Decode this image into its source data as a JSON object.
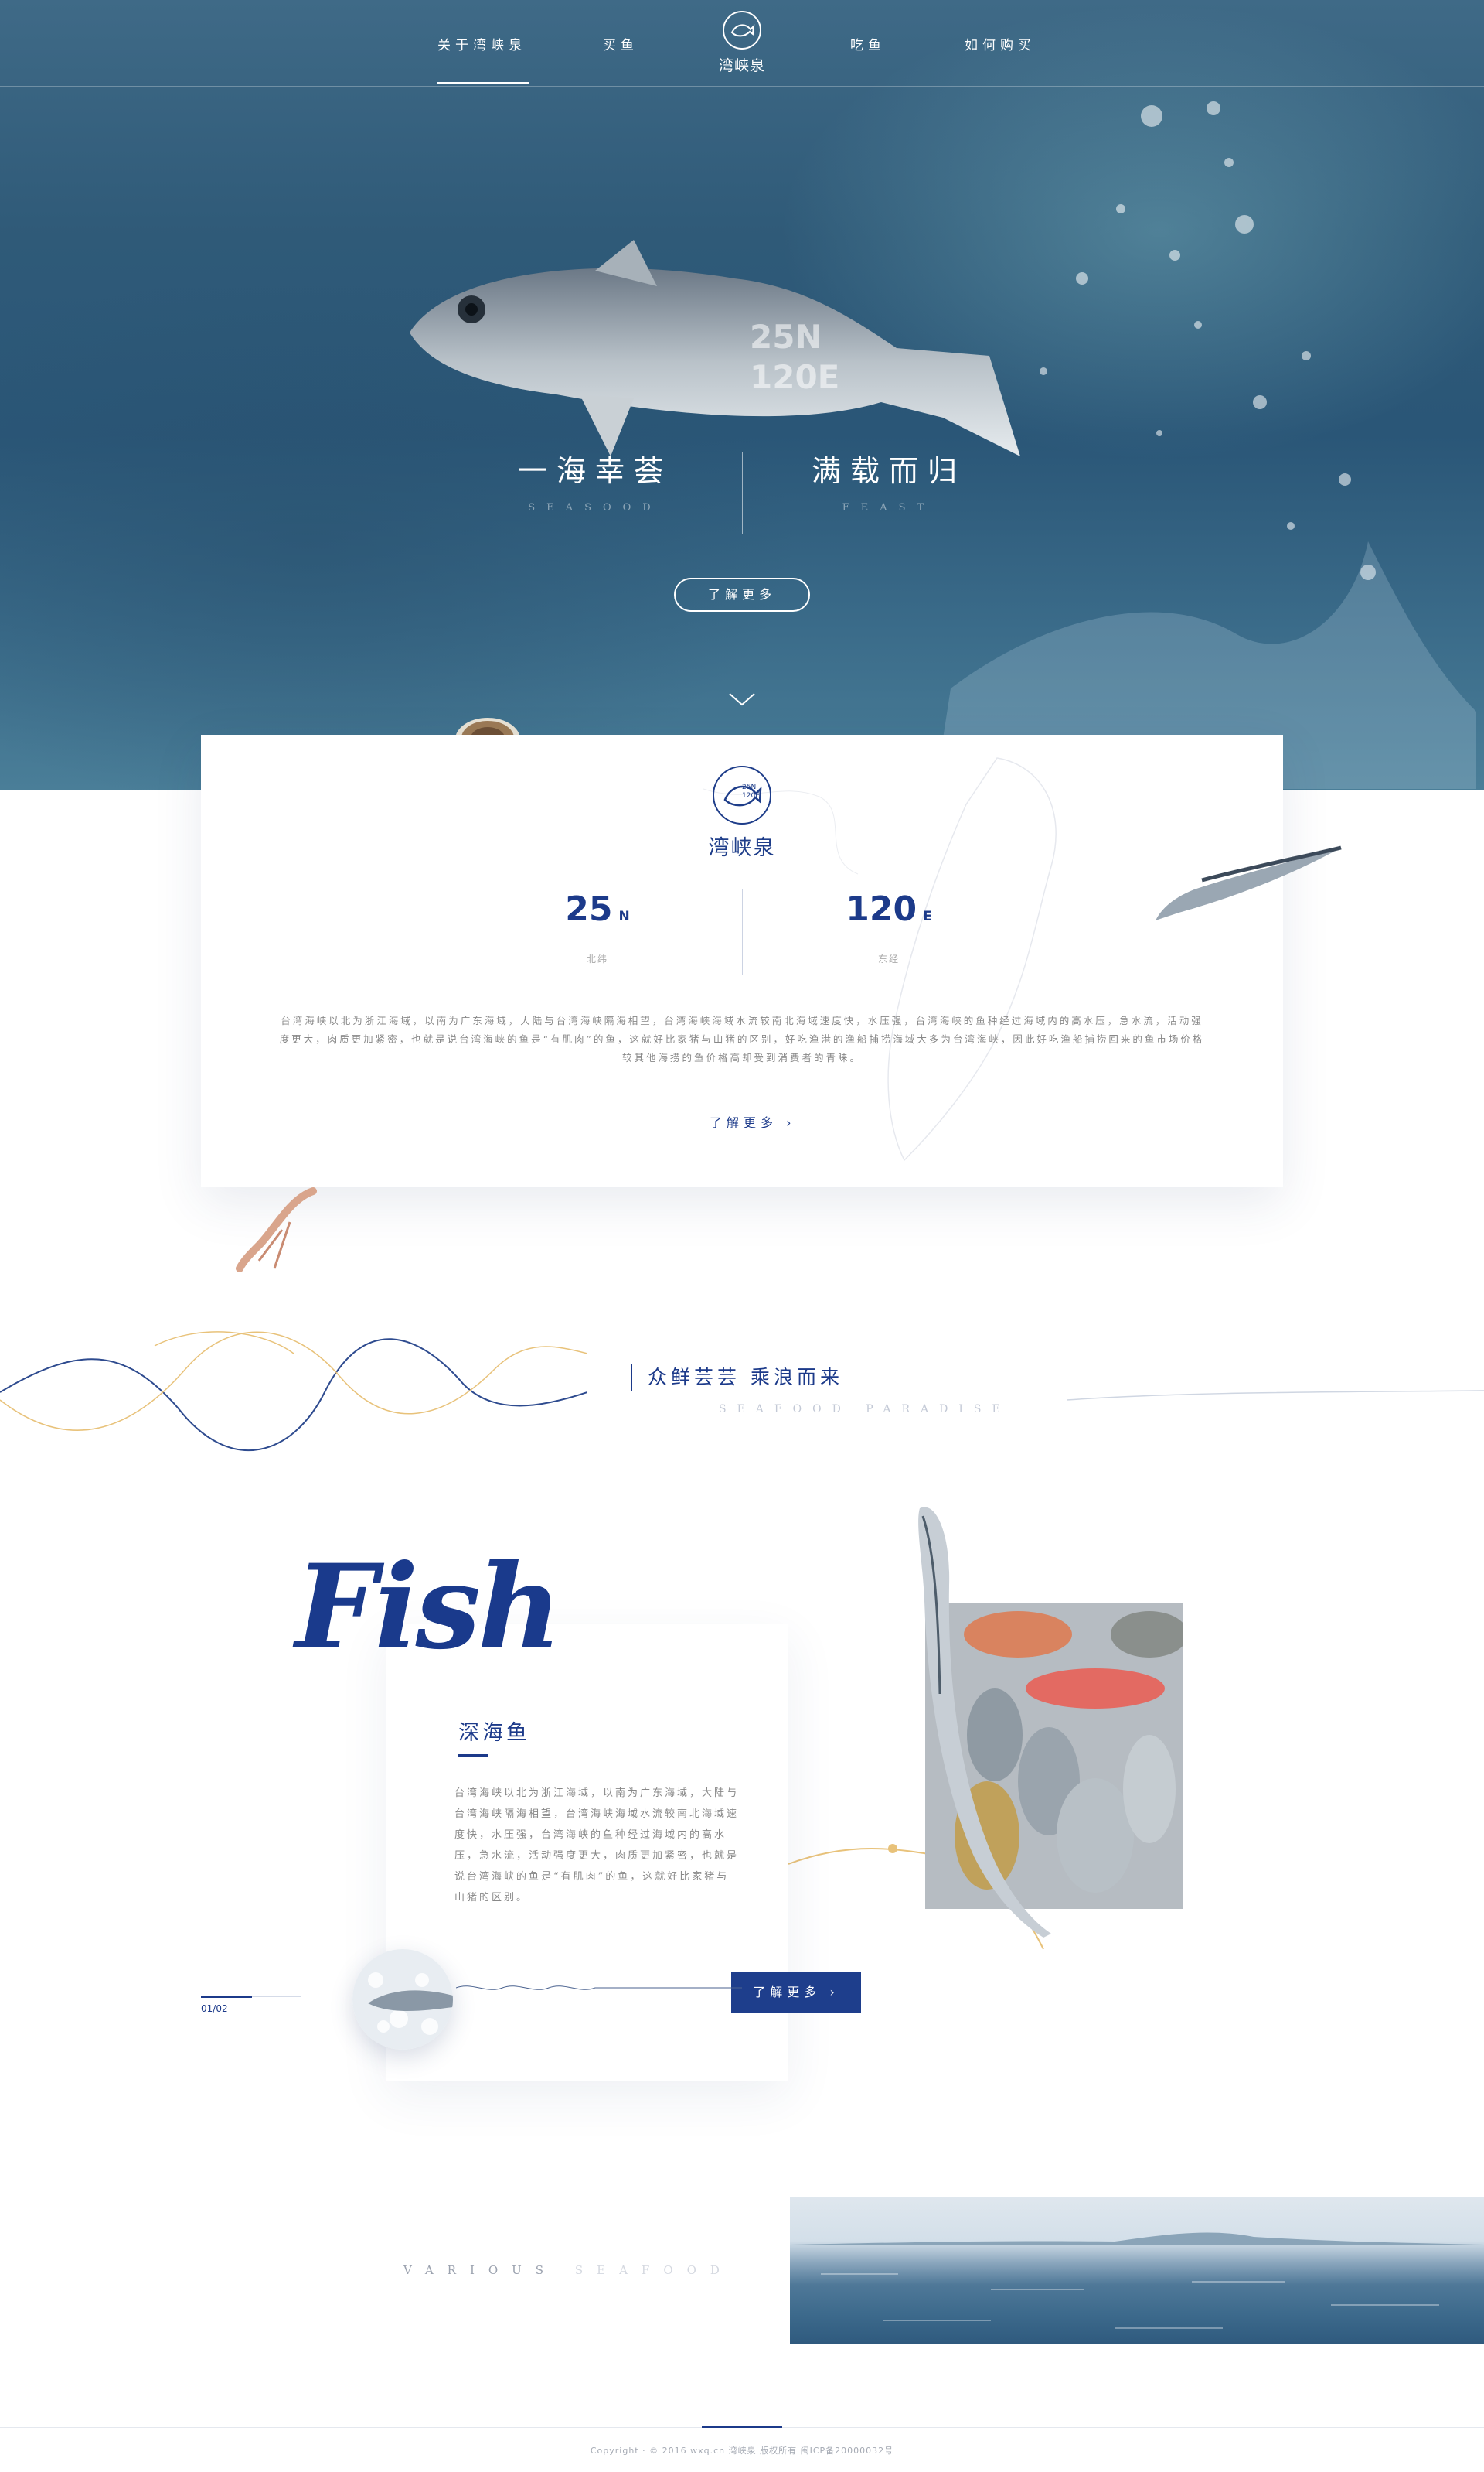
{
  "nav": {
    "items": [
      {
        "label": "关于湾峡泉"
      },
      {
        "label": "买鱼"
      },
      {
        "label": "吃鱼"
      },
      {
        "label": "如何购买"
      }
    ],
    "logo_text": "湾峡泉"
  },
  "hero": {
    "coord_line1": "25N",
    "coord_line2": "120E",
    "left_title": "一海幸荟",
    "left_subtitle": "SEASOOD",
    "right_title": "满载而归",
    "right_subtitle": "FEAST",
    "button_label": "了解更多"
  },
  "intro": {
    "logo_text": "湾峡泉",
    "logo_badge_1": "25N",
    "logo_badge_2": "120E",
    "stat_left": {
      "value": "25",
      "unit": "N",
      "label": "北纬"
    },
    "stat_right": {
      "value": "120",
      "unit": "E",
      "label": "东经"
    },
    "paragraph": "台湾海峡以北为浙江海域，以南为广东海域，大陆与台湾海峡隔海相望，台湾海峡海域水流较南北海域速度快，水压强，台湾海峡的鱼种经过海域内的高水压，急水流，活动强度更大，肉质更加紧密，也就是说台湾海峡的鱼是“有肌肉”的鱼，这就好比家猪与山猪的区别，好吃渔港的渔船捕捞海域大多为台湾海峡，因此好吃渔船捕捞回来的鱼市场价格较其他海捞的鱼价格高却受到消费者的青睐。",
    "more_label": "了解更多 ›"
  },
  "section": {
    "title": "众鲜芸芸  乘浪而来",
    "subtitle": "SEAFOOD  PARADISE",
    "script_word": "Fish",
    "card_title": "深海鱼",
    "card_text": "台湾海峡以北为浙江海域，以南为广东海域，大陆与台湾海峡隔海相望，台湾海峡海域水流较南北海域速度快，水压强，台湾海峡的鱼种经过海域内的高水压，急水流，活动强度更大，肉质更加紧密，也就是说台湾海峡的鱼是“有肌肉”的鱼，这就好比家猪与山猪的区别。",
    "button_label": "了解更多 ›",
    "pager": "01/02"
  },
  "various": {
    "word1": "VARIOUS",
    "word2": "SEAFOOD"
  },
  "footer": {
    "text": "Copyright · © 2016 wxq.cn 湾峡泉 版权所有 闽ICP备20000032号"
  },
  "colors": {
    "accent": "#1c3a8a",
    "hero": "#2f5a78",
    "gold": "#e8c27a"
  }
}
